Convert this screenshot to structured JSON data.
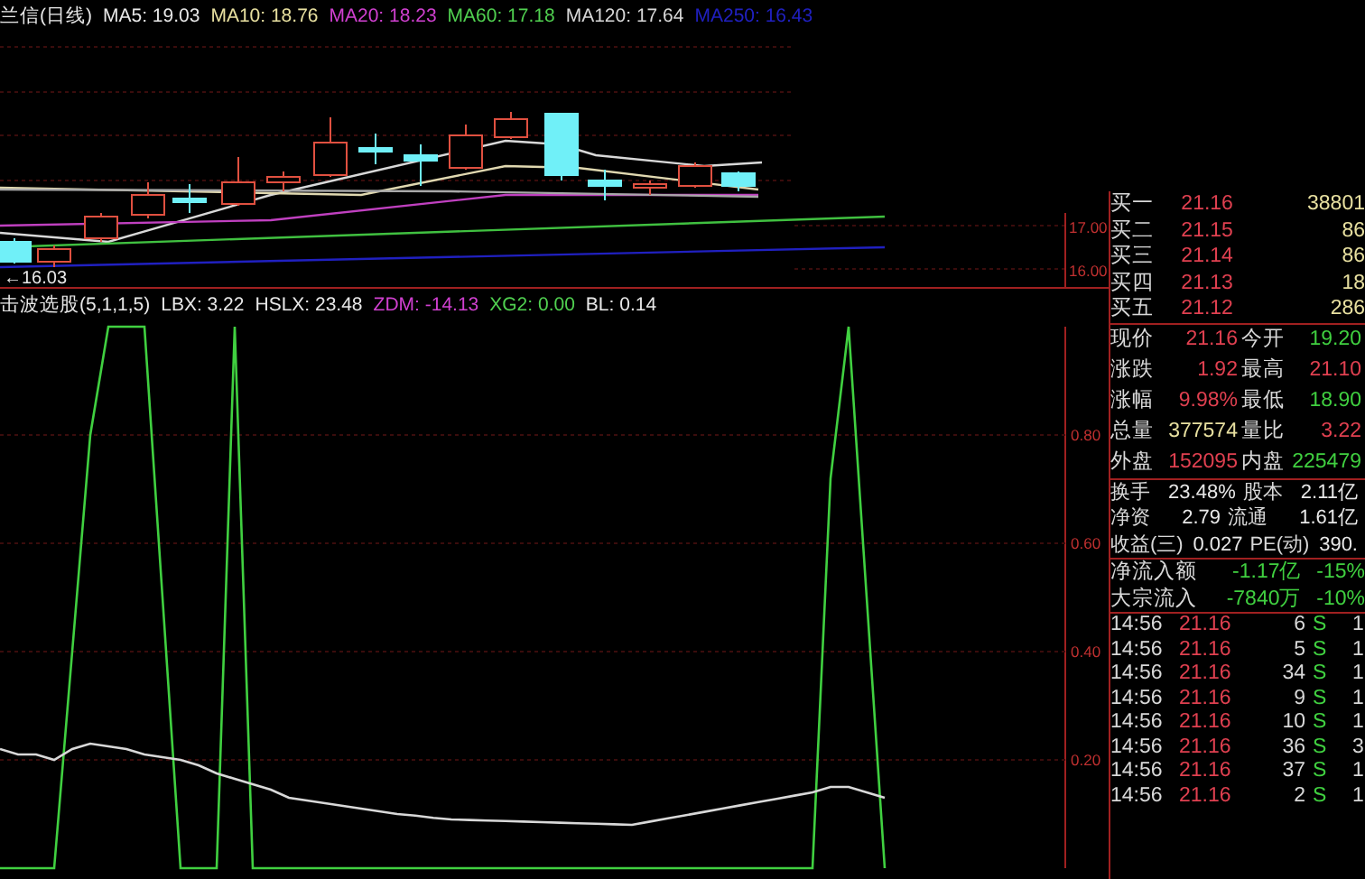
{
  "price_header": {
    "title": "兰信(日线)",
    "indicators": [
      {
        "label": "MA5: 19.03",
        "color": "#e8e8e8"
      },
      {
        "label": "MA10: 18.76",
        "color": "#e8e0a0"
      },
      {
        "label": "MA20: 18.23",
        "color": "#d040d0"
      },
      {
        "label": "MA60: 17.18",
        "color": "#50d050"
      },
      {
        "label": "MA120: 17.64",
        "color": "#d8d8d8"
      },
      {
        "label": "MA250: 16.43",
        "color": "#2020c0"
      }
    ]
  },
  "price_chart": {
    "axis_labels": [
      "17.00",
      "16.00"
    ],
    "low_marker": "←16.03"
  },
  "indicator_header": {
    "title": "击波选股(5,1,1,5)",
    "values": [
      {
        "label": "LBX: 3.22",
        "color": "#e8e8e8"
      },
      {
        "label": "HSLX: 23.48",
        "color": "#e8e8e8"
      },
      {
        "label": "ZDM: -14.13",
        "color": "#d040d0"
      },
      {
        "label": "XG2: 0.00",
        "color": "#50d050"
      },
      {
        "label": "BL: 0.14",
        "color": "#e8e8e8"
      }
    ]
  },
  "indicator_chart": {
    "chart_data": {
      "type": "line",
      "grid": true,
      "categories": [
        null,
        null,
        null,
        null,
        null,
        null,
        null,
        null,
        null,
        null,
        null,
        null,
        null,
        null,
        null,
        null,
        null,
        null,
        null,
        null,
        null,
        null,
        null,
        null,
        null,
        null,
        null,
        null,
        null,
        null,
        null,
        null,
        null,
        null,
        null,
        null,
        null,
        null,
        null,
        null,
        null,
        null,
        null,
        null,
        null,
        null,
        null,
        null,
        null,
        null
      ],
      "ylim": [
        0,
        1
      ],
      "yticks": [
        {
          "value": 0.2,
          "label": "0.20"
        },
        {
          "value": 0.4,
          "label": "0.40"
        },
        {
          "value": 0.6,
          "label": "0.60"
        },
        {
          "value": 0.8,
          "label": "0.80"
        }
      ],
      "series": [
        {
          "color": "#40d040",
          "values": [
            0,
            0,
            0,
            0,
            0.4,
            0.8,
            1,
            1,
            1,
            0.5,
            0,
            0,
            0,
            1,
            0,
            0,
            0,
            0,
            0,
            0,
            0,
            0,
            0,
            0,
            0,
            0,
            0,
            0,
            0,
            0,
            0,
            0,
            0,
            0,
            0,
            0,
            0,
            0,
            0,
            0,
            0,
            0,
            0,
            0,
            0,
            0,
            0.72,
            1,
            0.5,
            0
          ]
        },
        {
          "color": "#d8d8d8",
          "values": [
            0.22,
            0.21,
            0.21,
            0.2,
            0.22,
            0.23,
            0.225,
            0.22,
            0.21,
            0.205,
            0.2,
            0.19,
            0.175,
            0.165,
            0.155,
            0.145,
            0.13,
            0.125,
            0.12,
            0.115,
            0.11,
            0.105,
            0.1,
            0.097,
            0.093,
            0.09,
            0.089,
            0.088,
            0.087,
            0.086,
            0.085,
            0.084,
            0.083,
            0.082,
            0.081,
            0.08,
            0.086,
            0.092,
            0.098,
            0.104,
            0.11,
            0.116,
            0.122,
            0.128,
            0.134,
            0.14,
            0.15,
            0.15,
            0.14,
            0.13
          ]
        }
      ]
    }
  },
  "order_book": [
    {
      "label": "买一",
      "price": "21.16",
      "volume": "38801"
    },
    {
      "label": "买二",
      "price": "21.15",
      "volume": "86"
    },
    {
      "label": "买三",
      "price": "21.14",
      "volume": "86"
    },
    {
      "label": "买四",
      "price": "21.13",
      "volume": "18"
    },
    {
      "label": "买五",
      "price": "21.12",
      "volume": "286"
    }
  ],
  "quotes": [
    {
      "cells": [
        {
          "label": "现价",
          "value": "21.16",
          "color": "#e04050"
        },
        {
          "label": "今开",
          "value": "19.20",
          "color": "#40d040"
        }
      ]
    },
    {
      "cells": [
        {
          "label": "涨跌",
          "value": "1.92",
          "color": "#e04050"
        },
        {
          "label": "最高",
          "value": "21.10",
          "color": "#e04050"
        }
      ]
    },
    {
      "cells": [
        {
          "label": "涨幅",
          "value": "9.98%",
          "color": "#e04050"
        },
        {
          "label": "最低",
          "value": "18.90",
          "color": "#40d040"
        }
      ]
    },
    {
      "cells": [
        {
          "label": "总量",
          "value": "377574",
          "color": "#e8e0a0"
        },
        {
          "label": "量比",
          "value": "3.22",
          "color": "#e04050"
        }
      ]
    },
    {
      "cells": [
        {
          "label": "外盘",
          "value": "152095",
          "color": "#e04050"
        },
        {
          "label": "内盘",
          "value": "225479",
          "color": "#40d040"
        }
      ]
    }
  ],
  "fundamentals": [
    {
      "cells": [
        {
          "label": "换手",
          "value": "23.48%"
        },
        {
          "label": "股本",
          "value": "2.11亿"
        }
      ]
    },
    {
      "cells": [
        {
          "label": "净资",
          "value": "2.79"
        },
        {
          "label": "流通",
          "value": "1.61亿"
        }
      ]
    },
    {
      "cells": [
        {
          "label": "收益(三)",
          "value": "0.027"
        },
        {
          "label": "PE(动)",
          "value": "390."
        }
      ]
    }
  ],
  "flows": [
    {
      "label": "净流入额",
      "value": "-1.17亿",
      "percent": "-15%"
    },
    {
      "label": "大宗流入",
      "value": "-7840万",
      "percent": "-10%"
    }
  ],
  "trades": [
    {
      "time": "14:56",
      "price": "21.16",
      "volume": "6",
      "side": "S",
      "column_5": "1"
    },
    {
      "time": "14:56",
      "price": "21.16",
      "volume": "5",
      "side": "S",
      "column_5": "1"
    },
    {
      "time": "14:56",
      "price": "21.16",
      "volume": "34",
      "side": "S",
      "column_5": "1"
    },
    {
      "time": "14:56",
      "price": "21.16",
      "volume": "9",
      "side": "S",
      "column_5": "1"
    },
    {
      "time": "14:56",
      "price": "21.16",
      "volume": "10",
      "side": "S",
      "column_5": "1"
    },
    {
      "time": "14:56",
      "price": "21.16",
      "volume": "36",
      "side": "S",
      "column_5": "3"
    },
    {
      "time": "14:56",
      "price": "21.16",
      "volume": "37",
      "side": "S",
      "column_5": "1"
    },
    {
      "time": "14:56",
      "price": "21.16",
      "volume": "2",
      "side": "S",
      "column_5": "1"
    }
  ]
}
